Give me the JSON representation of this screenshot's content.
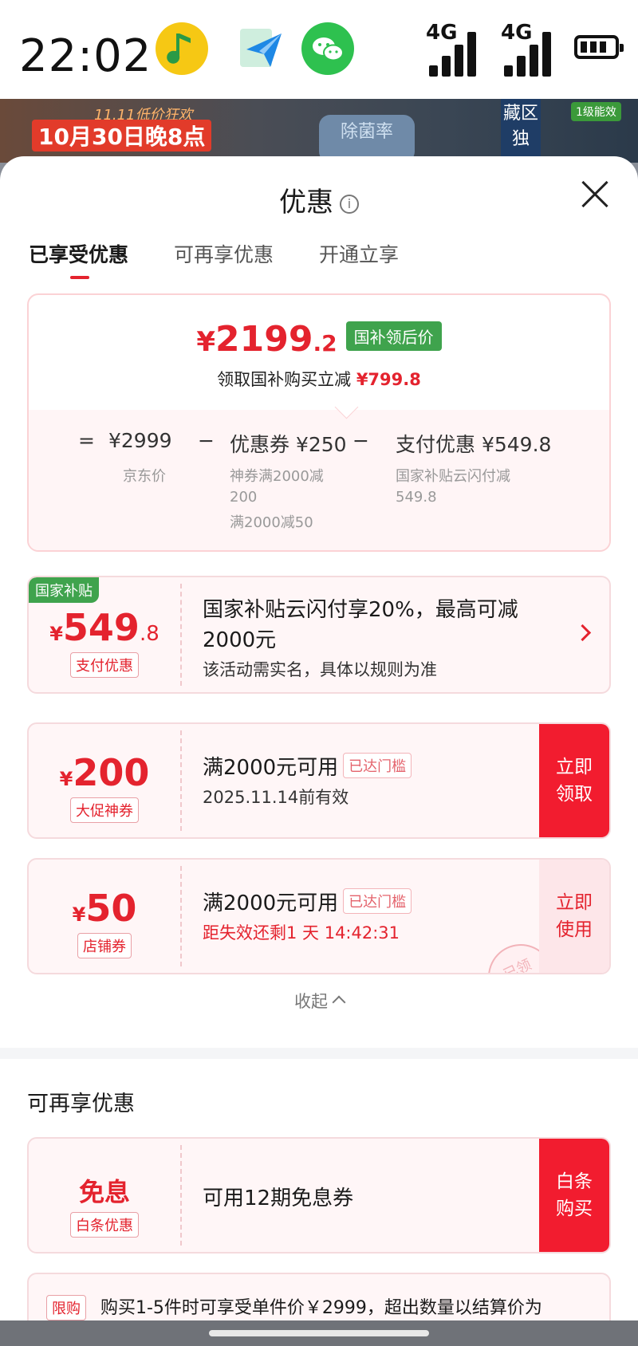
{
  "status_bar": {
    "time": "22:02",
    "network1": "4G",
    "network2": "4G",
    "apps": [
      "music-app-icon",
      "send-app-icon",
      "wechat-icon"
    ]
  },
  "banner": {
    "line1": "11.11低价狂欢",
    "line2": "10月30日晚8点",
    "mid": "除菌率",
    "side": "藏区独",
    "badge": "1级能效"
  },
  "sheet": {
    "title": "优惠",
    "tabs": [
      "已享受优惠",
      "可再享优惠",
      "开通立享"
    ]
  },
  "summary": {
    "currency": "¥",
    "final_int": "2199",
    "final_dec": ".2",
    "final_tag": "国补领后价",
    "save_text": "领取国补购买立减",
    "save_amount": "¥799.8",
    "eq": "=",
    "minus": "−",
    "jd_price": "¥2999",
    "jd_label": "京东价",
    "coupon_title": "优惠券 ¥250",
    "coupon_detail1": "神券满2000减",
    "coupon_detail2": "200",
    "coupon_detail3": "满2000减50",
    "pay_title": "支付优惠 ¥549.8",
    "pay_detail1": "国家补贴云闪付减",
    "pay_detail2": "549.8"
  },
  "cards": {
    "subsidy": {
      "corner": "国家补贴",
      "yen": "¥",
      "amount": "549",
      "decimal": ".8",
      "label": "支付优惠",
      "line1": "国家补贴云闪付享20%，最高可减",
      "line2": "2000元",
      "line3": "该活动需实名，具体以规则为准"
    },
    "promo": {
      "yen": "¥",
      "amount": "200",
      "label": "大促神券",
      "title": "满2000元可用",
      "reach": "已达门槛",
      "valid": "2025.11.14前有效",
      "action": "立即领取"
    },
    "store": {
      "yen": "¥",
      "amount": "50",
      "label": "店铺券",
      "title": "满2000元可用",
      "reach": "已达门槛",
      "countdown": "距失效还剩1 天 14:42:31",
      "action": "立即使用",
      "stamp": "已领"
    }
  },
  "collapse": "收起",
  "section2": {
    "title": "可再享优惠",
    "card": {
      "amount": "免息",
      "label": "白条优惠",
      "title": "可用12期免息券",
      "action": "白条购买"
    }
  },
  "limit": {
    "tag": "限购",
    "text": "购买1-5件时可享受单件价￥2999，超出数量以结算价为"
  },
  "colors": {
    "accent": "#e4232e",
    "button_red": "#f21c2f",
    "subsidy_green": "#3fa34d"
  }
}
